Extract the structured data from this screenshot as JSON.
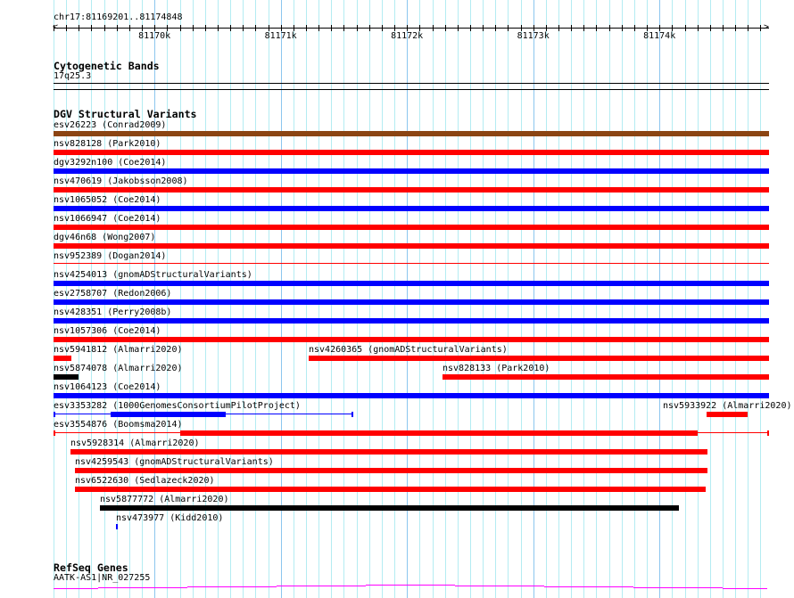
{
  "ruler": {
    "location": "chr17:81169201..81174848",
    "start": 81169201,
    "end": 81174848,
    "tick_labels": [
      {
        "pos": 81170000,
        "label": "81170k"
      },
      {
        "pos": 81171000,
        "label": "81171k"
      },
      {
        "pos": 81172000,
        "label": "81172k"
      },
      {
        "pos": 81173000,
        "label": "81173k"
      },
      {
        "pos": 81174000,
        "label": "81174k"
      }
    ]
  },
  "cytobands": {
    "title": "Cytogenetic Bands",
    "band": "17q25.3"
  },
  "dgv": {
    "title": "DGV Structural Variants",
    "features": [
      {
        "label": "esv26223 (Conrad2009)",
        "start": 81169201,
        "end": 81174870,
        "color": "#8b4513"
      },
      {
        "label": "nsv828128 (Park2010)",
        "start": 81169201,
        "end": 81174870,
        "color": "#ff0000"
      },
      {
        "label": "dgv3292n100 (Coe2014)",
        "start": 81169201,
        "end": 81174870,
        "color": "#0000ff"
      },
      {
        "label": "nsv470619 (Jakobsson2008)",
        "start": 81169201,
        "end": 81174870,
        "color": "#ff0000"
      },
      {
        "label": "nsv1065052 (Coe2014)",
        "start": 81169201,
        "end": 81174870,
        "color": "#0000ff"
      },
      {
        "label": "nsv1066947 (Coe2014)",
        "start": 81169201,
        "end": 81174870,
        "color": "#ff0000"
      },
      {
        "label": "dgv46n68 (Wong2007)",
        "start": 81169201,
        "end": 81174870,
        "color": "#ff0000"
      },
      {
        "label": "nsv952389 (Dogan2014)",
        "start": 81169201,
        "end": 81174870,
        "color": "#ff0000",
        "thin": true
      },
      {
        "label": "nsv4254013 (gnomADStructuralVariants)",
        "start": 81169201,
        "end": 81174870,
        "color": "#0000ff"
      },
      {
        "label": "esv2758707 (Redon2006)",
        "start": 81169201,
        "end": 81174870,
        "color": "#0000ff"
      },
      {
        "label": "nsv428351 (Perry2008b)",
        "start": 81169201,
        "end": 81174870,
        "color": "#0000ff"
      },
      {
        "label": "nsv1057306 (Coe2014)",
        "start": 81169201,
        "end": 81174870,
        "color": "#ff0000"
      },
      {
        "label": "nsv5941812 (Almarri2020)",
        "start": 81169201,
        "end": 81169342,
        "color": "#ff0000"
      },
      {
        "label": "nsv4260365 (gnomADStructuralVariants)",
        "start": 81171222,
        "end": 81174870,
        "color": "#ff0000"
      },
      {
        "label": "nsv5874078 (Almarri2020)",
        "start": 81169201,
        "end": 81169399,
        "color": "#000000"
      },
      {
        "label": "nsv828133 (Park2010)",
        "start": 81172282,
        "end": 81174870,
        "color": "#ff0000"
      },
      {
        "label": "nsv1064123 (Coe2014)",
        "start": 81169201,
        "end": 81174870,
        "color": "#0000ff"
      },
      {
        "label": "esv3353282 (1000GenomesConsortiumPilotProject)",
        "start": 81169201,
        "end": 81171575,
        "thick_start": 81169653,
        "thick_end": 81170565,
        "color": "#0000ff"
      },
      {
        "label": "nsv5933922 (Almarri2020)",
        "start": 81174374,
        "end": 81174699,
        "color": "#ff0000"
      },
      {
        "label": "esv3554876 (Boomsma2014)",
        "start": 81169201,
        "end": 81174870,
        "thick_start": 81170204,
        "thick_end": 81174303,
        "color": "#ff0000"
      },
      {
        "label": "nsv5928314 (Almarri2020)",
        "start": 81169335,
        "end": 81174381,
        "color": "#ff0000"
      },
      {
        "label": "nsv4259543 (gnomADStructuralVariants)",
        "start": 81169371,
        "end": 81174381,
        "color": "#ff0000"
      },
      {
        "label": "nsv6522630 (Sedlazeck2020)",
        "start": 81169371,
        "end": 81174367,
        "color": "#ff0000"
      },
      {
        "label": "nsv5877772 (Almarri2020)",
        "start": 81169568,
        "end": 81174155,
        "color": "#000000"
      },
      {
        "label": "nsv473977 (Kidd2010)",
        "start": 81169695,
        "end": 81169710,
        "color": "#0000ff"
      }
    ]
  },
  "refseq": {
    "title": "RefSeq Genes",
    "gene": "AATK-AS1|NR_027255",
    "color": "#ff00ff"
  }
}
